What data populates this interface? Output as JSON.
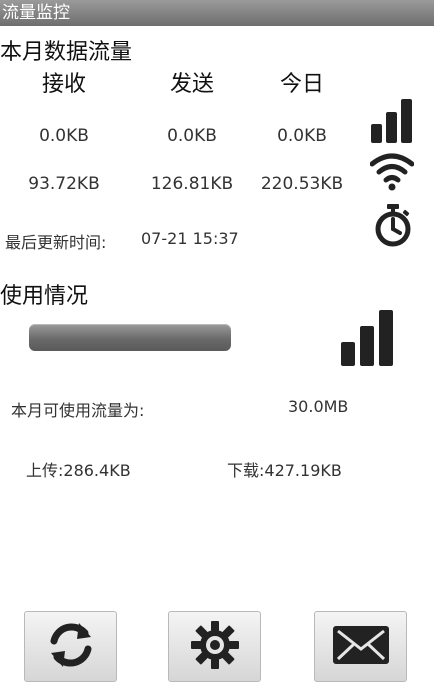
{
  "app": {
    "title": "流量监控"
  },
  "month_section": {
    "heading": "本月数据流量",
    "columns": [
      "接收",
      "发送",
      "今日"
    ],
    "row_mobile": [
      "0.0KB",
      "0.0KB",
      "0.0KB"
    ],
    "row_wifi": [
      "93.72KB",
      "126.81KB",
      "220.53KB"
    ],
    "last_update_label": "最后更新时间:",
    "last_update_value": "07-21 15:37"
  },
  "usage_section": {
    "heading": "使用情况",
    "usage_fraction": 0.0,
    "available_label": "本月可使用流量为:",
    "available_value": "30.0MB",
    "upload": "上传:286.4KB",
    "download": "下载:427.19KB"
  },
  "toolbar": {
    "buttons": [
      {
        "name": "refresh",
        "icon": "refresh-icon"
      },
      {
        "name": "settings",
        "icon": "gear-icon"
      },
      {
        "name": "message",
        "icon": "envelope-icon"
      }
    ]
  },
  "colors": {
    "icon": "#222222",
    "bar": "#707070",
    "titlebar": "#7d7d7d"
  }
}
